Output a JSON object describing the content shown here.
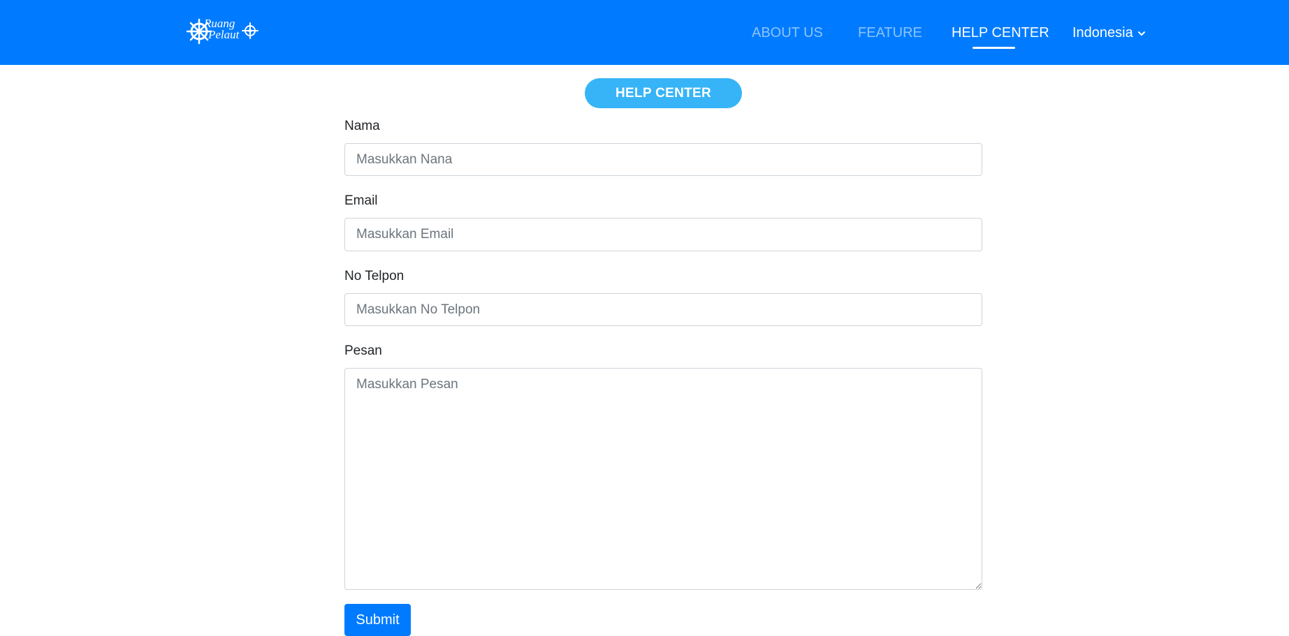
{
  "brand": {
    "logo_line1": "Ruang",
    "logo_line2": "Pelaut"
  },
  "nav": {
    "items": [
      {
        "label": "ABOUT US",
        "active": false
      },
      {
        "label": "FEATURE",
        "active": false
      },
      {
        "label": "HELP CENTER",
        "active": true
      }
    ],
    "language": "Indonesia"
  },
  "page": {
    "badge": "HELP CENTER"
  },
  "form": {
    "name": {
      "label": "Nama",
      "placeholder": "Masukkan Nana",
      "value": ""
    },
    "email": {
      "label": "Email",
      "placeholder": "Masukkan Email",
      "value": ""
    },
    "phone": {
      "label": "No Telpon",
      "placeholder": "Masukkan No Telpon",
      "value": ""
    },
    "message": {
      "label": "Pesan",
      "placeholder": "Masukkan Pesan",
      "value": ""
    },
    "submit_label": "Submit"
  },
  "colors": {
    "navbar": "#007bff",
    "badge": "#36b4f7",
    "submit": "#007bff",
    "nav_inactive": "rgba(255,255,255,0.55)",
    "nav_active": "#ffffff"
  },
  "icons": {
    "logo": "ship-wheel-logo-icon",
    "language_dropdown": "chevron-down-icon"
  }
}
